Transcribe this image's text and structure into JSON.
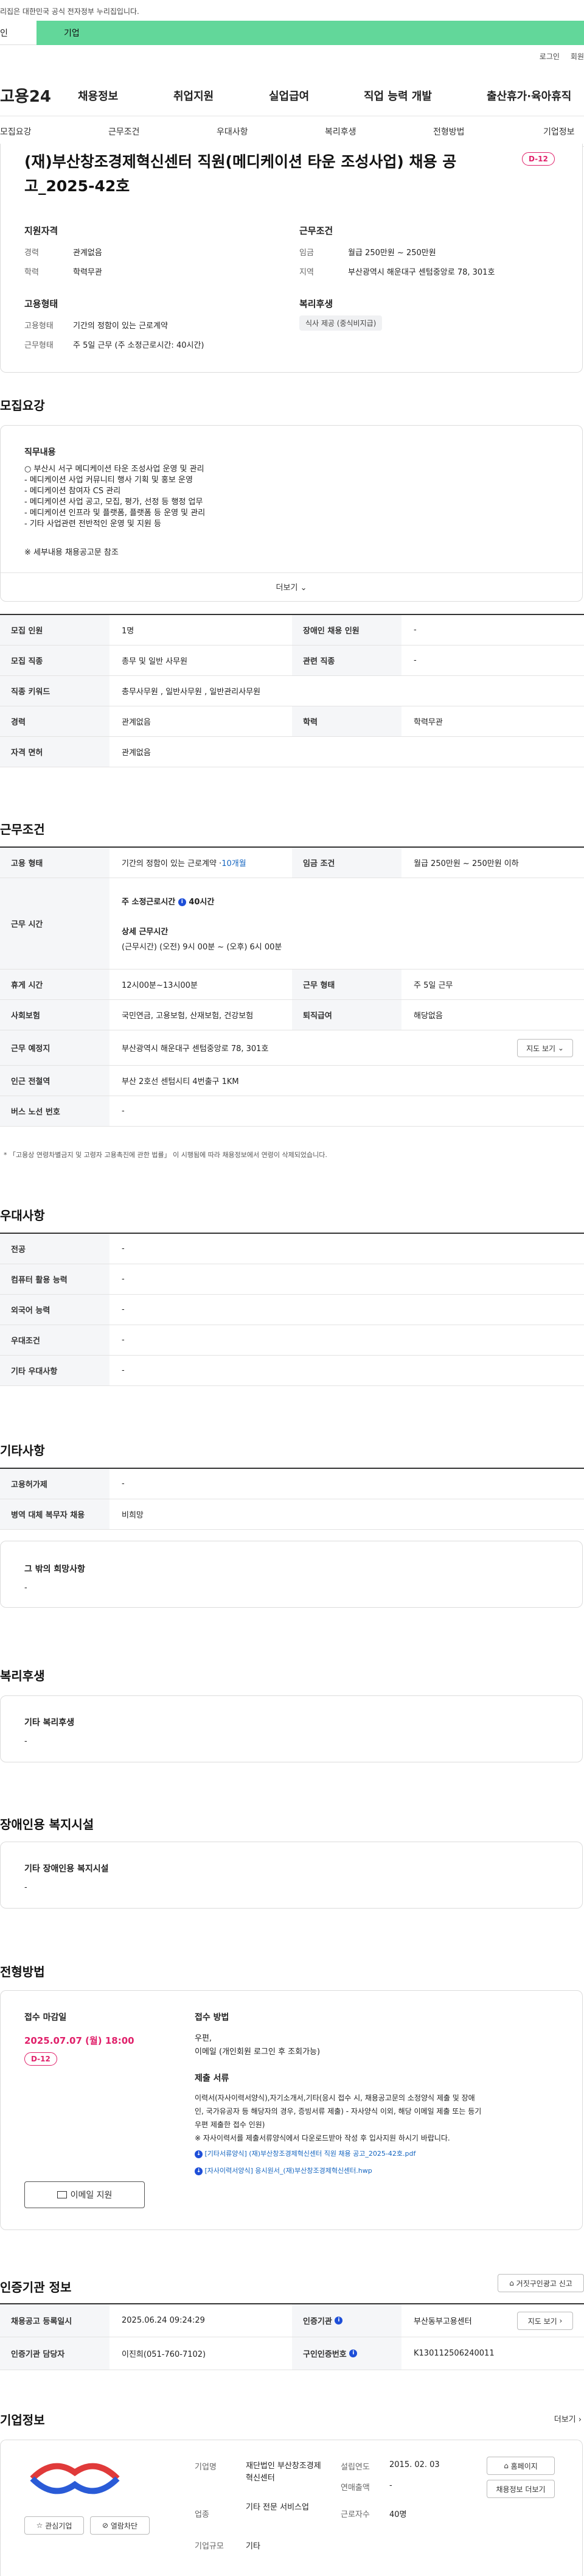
{
  "header": {
    "notice": "리집은 대한민국 공식 전자정부 누리집입니다.",
    "aud_left": "인",
    "aud_right": "기업",
    "utility": [
      "로그인",
      "회원"
    ],
    "logo": "고용24",
    "menu": [
      "채용정보",
      "취업지원",
      "실업급여",
      "직업 능력 개발",
      "출산휴가·육아휴직"
    ],
    "subtabs": [
      "모집요강",
      "근무조건",
      "우대사항",
      "복리후생",
      "전형방법",
      "기업정보"
    ]
  },
  "job": {
    "title": "(재)부산창조경제혁신센터 직원(메디케이션 타운 조성사업) 채용 공고_2025-42호",
    "dday": "D-12",
    "summary": {
      "qual_title": "지원자격",
      "career_label": "경력",
      "career": "관계없음",
      "edu_label": "학력",
      "edu": "학력무관",
      "cond_title": "근무조건",
      "wage_label": "임금",
      "wage": "월급 250만원 ~ 250만원",
      "region_label": "지역",
      "region": "부산광역시 해운대구 센텀중앙로 78, 301호",
      "emp_title": "고용형태",
      "emptype_label": "고용형태",
      "emptype": "기간의 정함이 있는 근로계약",
      "worktype_label": "근무형태",
      "worktype": "주 5일 근무 (주 소정근로시간: 40시간)",
      "welfare_title": "복리후생",
      "welfare_tag": "식사 제공 (중식비지급)"
    }
  },
  "recruit": {
    "section": "모집요강",
    "duty_title": "직무내용",
    "duties": [
      "부산시 서구 메디케이션 타운 조성사업 운영 및 관리",
      "- 메디케이션 사업 커뮤니티 행사 기획 및 홍보 운영",
      "- 메디케이션 참여자 CS 관리",
      "- 메디케이션 사업 공고, 모집, 평가, 선정 등 행정 업무",
      "- 메디케이션 인프라 및 플랫폼, 플랫폼 등 운영 및 관리",
      "- 기타 사업관련 전반적인 운영 및 지원 등"
    ],
    "note": "※ 세부내용 채용공고문 참조",
    "more": "더보기",
    "rows": {
      "count_label": "모집 인원",
      "count": "1명",
      "disabled_label": "장애인 채용 인원",
      "disabled": "-",
      "job_label": "모집 직종",
      "job": "총무 및 일반 사무원",
      "related_label": "관련 직종",
      "related": "-",
      "kw_label": "직종 키워드",
      "kw": "총무사무원 , 일반사무원 , 일반관리사무원",
      "career_label": "경력",
      "career": "관계없음",
      "edu_label": "학력",
      "edu": "학력무관",
      "license_label": "자격 면허",
      "license": "관계없음"
    }
  },
  "work": {
    "section": "근무조건",
    "emptype_label": "고용 형태",
    "emptype": "기간의 정함이 있는 근로계약 · ",
    "emptype_months": "10개월",
    "wage_label": "임금 조건",
    "wage": "월급 250만원 ~ 250만원 이하",
    "time_label": "근무 시간",
    "hours_title": "주 소정근로시간",
    "hours_value": "40시간",
    "detail_title": "상세 근무시간",
    "detail_value": "(근무시간) (오전) 9시 00분 ~ (오후) 6시 00분",
    "break_label": "휴게 시간",
    "break": "12시00분~13시00분",
    "form_label": "근무 형태",
    "form": "주 5일 근무",
    "ins_label": "사회보험",
    "ins": "국민연금, 고용보험, 산재보험, 건강보험",
    "retire_label": "퇴직급여",
    "retire": "해당없음",
    "place_label": "근무 예정지",
    "place": "부산광역시 해운대구 센텀중앙로 78, 301호",
    "map_btn": "지도 보기",
    "subway_label": "인근 전철역",
    "subway": "부산 2호선 센텀시티 4번출구 1KM",
    "bus_label": "버스 노선 번호",
    "bus": "-",
    "footnote": "* 「고용상 연령차별금지 및 고령자 고용촉진에 관한 법률」 이 시행됨에 따라 채용정보에서 연령이 삭제되었습니다."
  },
  "pref": {
    "section": "우대사항",
    "rows": [
      {
        "label": "전공",
        "value": "-"
      },
      {
        "label": "컴퓨터 활용 능력",
        "value": "-"
      },
      {
        "label": "외국어 능력",
        "value": "-"
      },
      {
        "label": "우대조건",
        "value": "-"
      },
      {
        "label": "기타 우대사항",
        "value": "-"
      }
    ]
  },
  "etc": {
    "section": "기타사항",
    "rows": [
      {
        "label": "고용허가제",
        "value": "-"
      },
      {
        "label": "병역 대체 복무자 채용",
        "value": "비희망"
      }
    ],
    "other_title": "그 밖의 희망사항",
    "other_value": "-"
  },
  "welfare": {
    "section": "복리후생",
    "title": "기타 복리후생",
    "value": "-"
  },
  "facility": {
    "section": "장애인용 복지시설",
    "title": "기타 장애인용 복지시설",
    "value": "-"
  },
  "apply": {
    "section": "전형방법",
    "deadline_label": "접수 마감일",
    "deadline": "2025.07.07 (월) 18:00",
    "dday": "D-12",
    "mail_btn": "이메일 지원",
    "method_title": "접수 방법",
    "method_lines": [
      "우편,",
      "이메일 (개인회원 로그인 후 조회가능)"
    ],
    "docs_title": "제출 서류",
    "docs_lines": [
      "이력서(자사이력서양식),자기소개서,기타(응시 접수 시, 채용공고문의 소정양식 제출 및 장애",
      "인, 국가유공자 등 해당자의 경우, 증빙서류 제출) - 자사양식 이외, 해당 이메일 제출 또는 등기",
      "우편 제출한 접수 인원)",
      "※ 자사이력서를 제출서류양식에서 다운로드받아 작성 후 입사지원 하시기 바랍니다."
    ],
    "files": [
      "[기타서류양식] (재)부산창조경제혁신센터 직원 채용 공고_2025-42호.pdf",
      "[자사이력서양식] 응시원서_(재)부산창조경제혁신센터.hwp"
    ]
  },
  "agency": {
    "section": "인증기관 정보",
    "report_btn": "거짓구인광고 신고",
    "reg_label": "채용공고 등록일시",
    "reg": "2025.06.24 09:24:29",
    "org_label": "인증기관",
    "org": "부산동부고용센터",
    "map_btn": "지도 보기",
    "mgr_label": "인증기관 담당자",
    "mgr": "이진희(051-760-7102)",
    "no_label": "구인인증번호",
    "no": "K130112506240011"
  },
  "company": {
    "section": "기업정보",
    "more": "더보기",
    "interest_btn": "관심기업",
    "block_btn": "열람차단",
    "name_label": "기업명",
    "name": "재단법인 부산창조경제혁신센터",
    "est_label": "설립연도",
    "est": "2015. 02. 03",
    "sales_label": "연매출액",
    "sales": "-",
    "biz_label": "업종",
    "biz": "기타 전문 서비스업",
    "emp_label": "근로자수",
    "emp": "40명",
    "size_label": "기업규모",
    "size": "기타",
    "home_btn": "홈페이지",
    "jobs_btn": "채용정보 더보기"
  },
  "colors": {
    "accent": "#e0206a",
    "green": "#62d79a",
    "blue": "#1e4fd8",
    "deadline": "#e0206a"
  }
}
